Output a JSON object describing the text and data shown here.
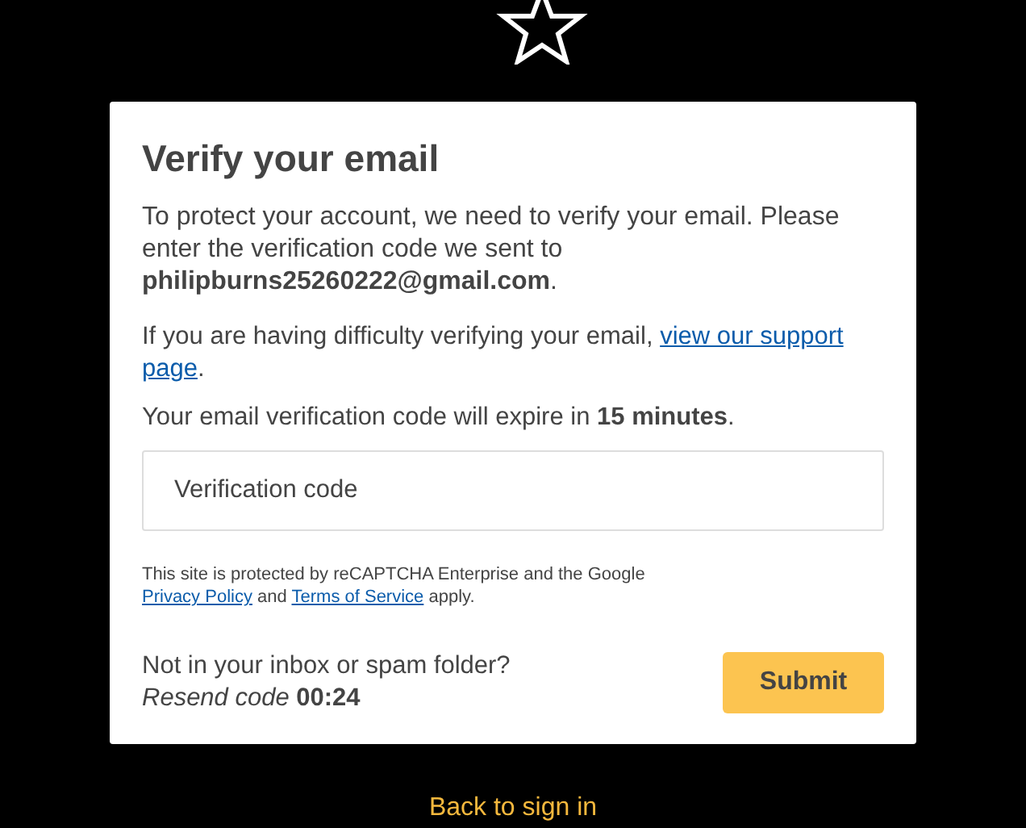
{
  "title": "Verify your email",
  "intro": {
    "text": "To protect your account, we need to verify your email. Please enter the verification code we sent to",
    "email": "philipburns25260222@gmail.com",
    "end": "."
  },
  "support": {
    "text": "If you are having difficulty verifying your email,",
    "link_lines": [
      "view our support",
      "page"
    ],
    "end": "."
  },
  "expiry": "Your email verification code will expire in **15 minutes**.",
  "code_field": {
    "placeholder": "Verification code"
  },
  "recaptcha": {
    "text": "This site is protected by reCAPTCHA Enterprise and the Google",
    "privacy": "Privacy Policy",
    "and": "and",
    "terms": "Terms of Service",
    "end": "apply."
  },
  "resend": {
    "question": "Not in your inbox or spam folder?",
    "label": "Resend code",
    "timer": "00:24"
  },
  "submit": "Submit",
  "back_link": "Back to sign in"
}
